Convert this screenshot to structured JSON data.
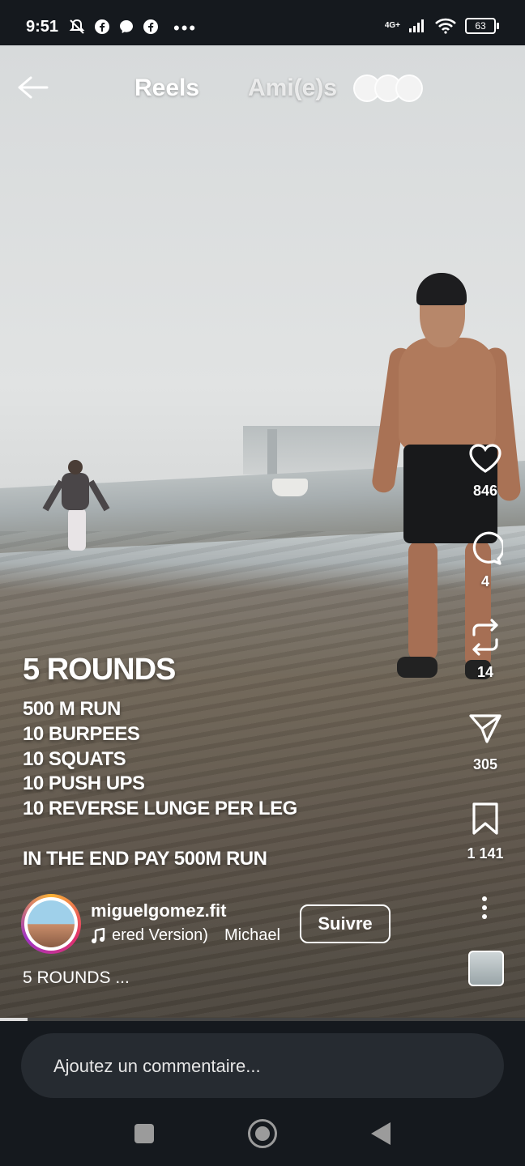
{
  "status_bar": {
    "time": "9:51",
    "more": "•••",
    "network": "4G+",
    "battery": "63"
  },
  "header": {
    "tab_reels": "Reels",
    "tab_friends": "Ami(e)s"
  },
  "video_caption": {
    "title": "5 ROUNDS",
    "lines": [
      "500 M RUN",
      "10 BURPEES",
      "10 SQUATS",
      "10 PUSH UPS",
      "10 REVERSE LUNGE PER LEG"
    ],
    "final": "IN THE END PAY 500M RUN"
  },
  "actions": {
    "likes": "846",
    "comments": "4",
    "reposts": "14",
    "shares": "305",
    "saves": "1 141"
  },
  "author": {
    "username": "miguelgomez.fit",
    "music": "ered Version)",
    "music_artist": "Michael",
    "follow_label": "Suivre"
  },
  "caption_preview": "5 ROUNDS ...",
  "comment": {
    "placeholder": "Ajoutez un commentaire..."
  }
}
